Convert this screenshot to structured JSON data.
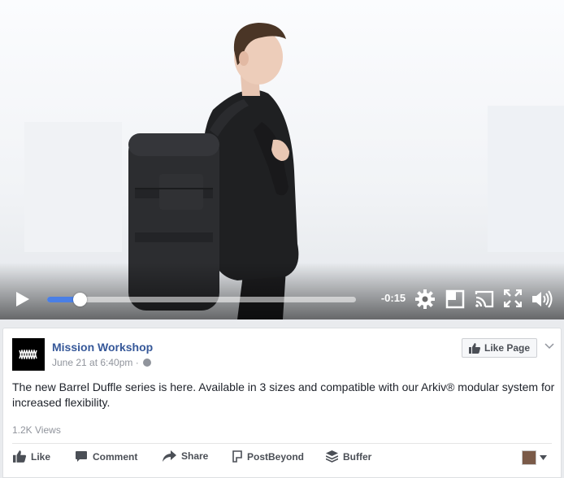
{
  "video": {
    "time_remaining": "-0:15",
    "progress_fraction": 0.105,
    "accent_color": "#4a7fe6",
    "icons": [
      "play-icon",
      "gear-icon",
      "picture-in-picture-icon",
      "cast-icon",
      "fullscreen-icon",
      "volume-icon"
    ]
  },
  "post": {
    "page_name": "Mission Workshop",
    "timestamp": "June 21 at 6:40pm",
    "separator": "·",
    "like_page_label": "Like Page",
    "text": "The new Barrel Duffle series is here. Available in 3 sizes and compatible with our Arkiv® modular system for increased flexibility.",
    "views": "1.2K Views",
    "name_color": "#365899"
  },
  "actions": {
    "like": "Like",
    "comment": "Comment",
    "share": "Share",
    "postbeyond": "PostBeyond",
    "buffer": "Buffer"
  }
}
